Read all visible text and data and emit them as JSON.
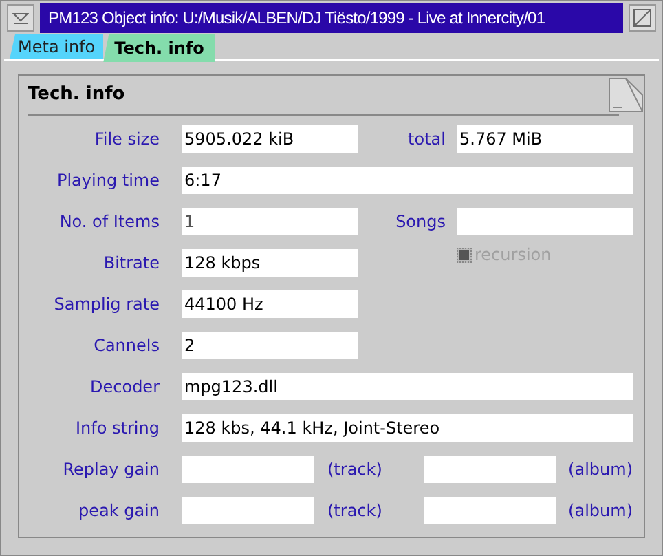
{
  "window": {
    "title": "PM123 Object info: U:/Musik/ALBEN/DJ Tiësto/1999 - Live at Innercity/01"
  },
  "tabs": [
    {
      "label": "Meta info",
      "selected": false,
      "color": "#55d4fb"
    },
    {
      "label": "Tech. info",
      "selected": true,
      "color": "#84dcac"
    }
  ],
  "page": {
    "heading": "Tech. info"
  },
  "rows": [
    {
      "kind": "pair",
      "label": "File size",
      "value": "5905.022 kiB",
      "label2": "total",
      "value2": "5.767 MiB"
    },
    {
      "kind": "full",
      "label": "Playing time",
      "value": "6:17"
    },
    {
      "kind": "pair",
      "label": "No. of Items",
      "value": "1",
      "value_disabled": true,
      "label2": "Songs",
      "value2": ""
    },
    {
      "kind": "check",
      "label": "Bitrate",
      "value": "128 kbps",
      "checkbox": {
        "label": "recursion",
        "checked": true,
        "disabled": true
      }
    },
    {
      "kind": "single",
      "label": "Samplig rate",
      "value": "44100 Hz"
    },
    {
      "kind": "single",
      "label": "Cannels",
      "value": "2"
    },
    {
      "kind": "full",
      "label": "Decoder",
      "value": "mpg123.dll"
    },
    {
      "kind": "full",
      "label": "Info string",
      "value": "128 kbs, 44.1 kHz, Joint-Stereo"
    },
    {
      "kind": "gain",
      "label": "Replay gain",
      "suffix": "(track)",
      "suffix2": "(album)"
    },
    {
      "kind": "gain",
      "label": "peak gain",
      "suffix": "(track)",
      "suffix2": "(album)"
    }
  ]
}
